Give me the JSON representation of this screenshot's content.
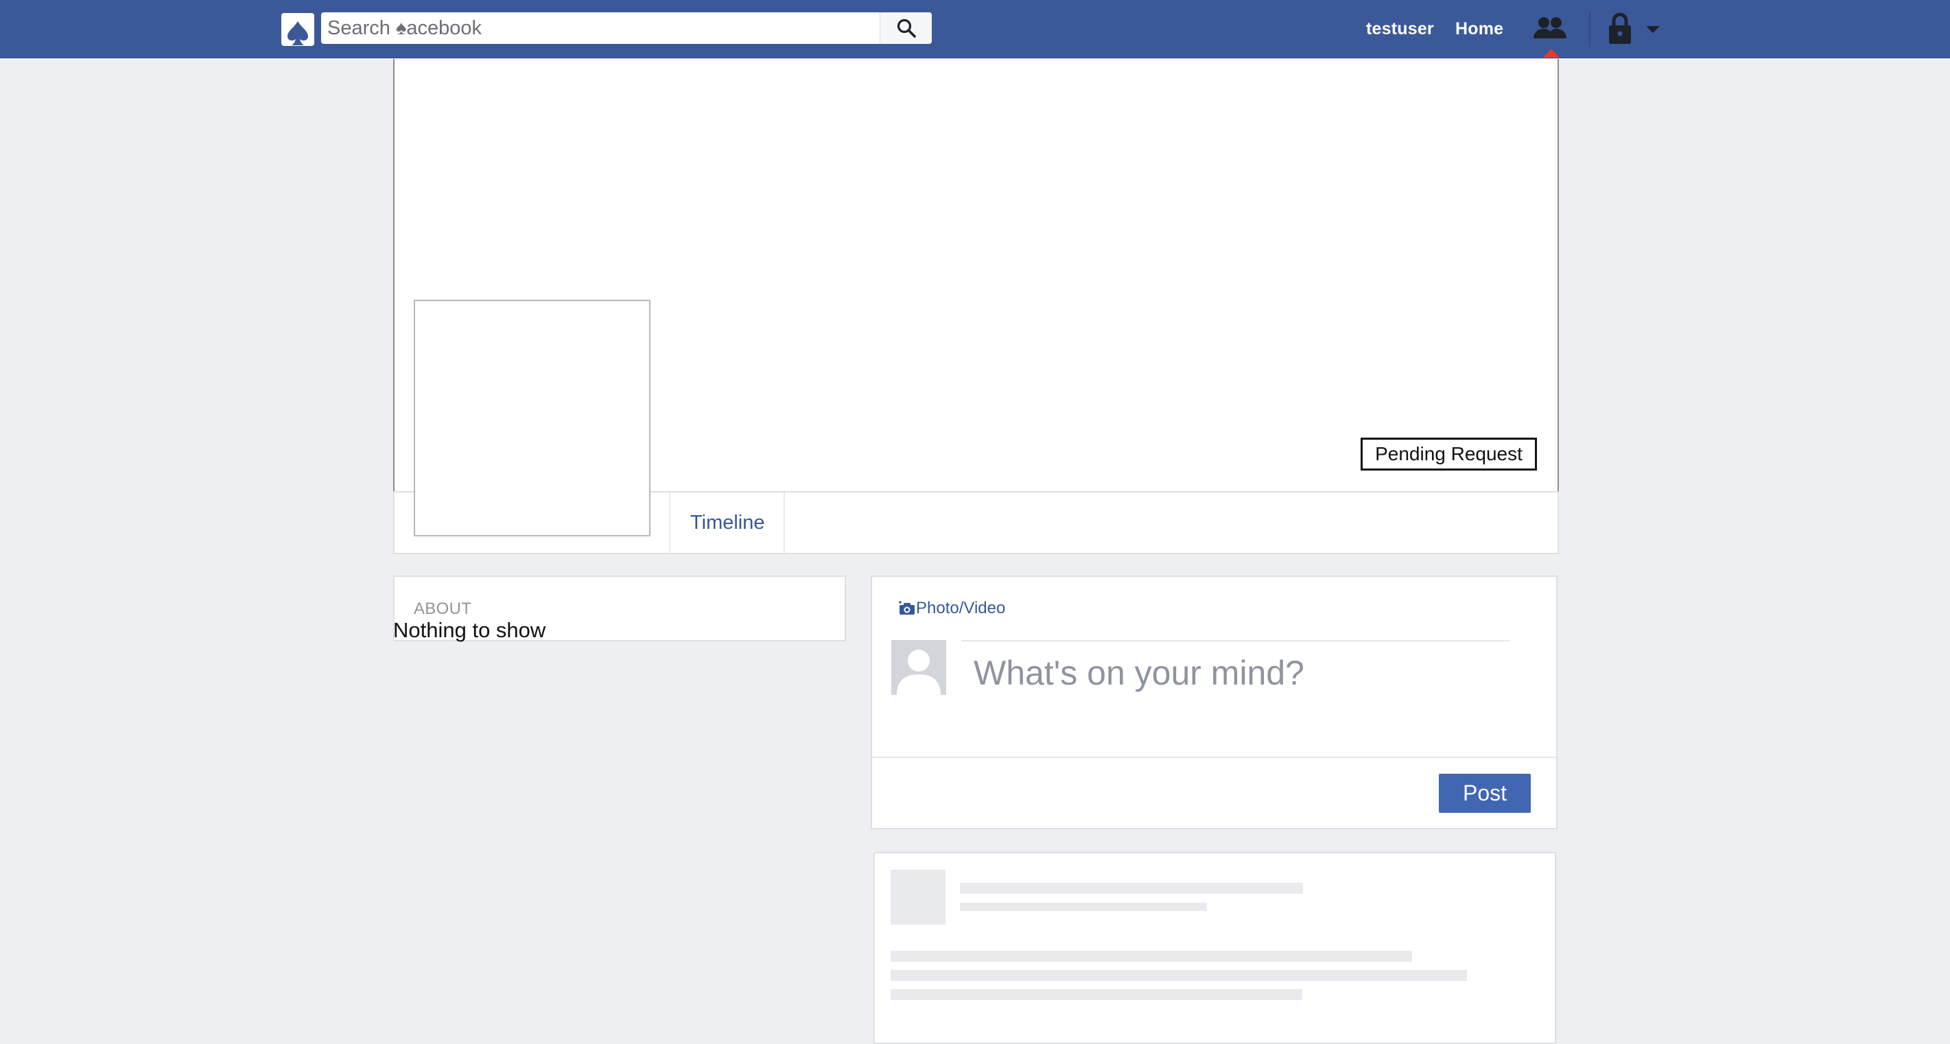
{
  "topbar": {
    "search_placeholder": "Search ♠acebook",
    "user_label": "testuser",
    "home_label": "Home",
    "icons": [
      "spade-logo-icon",
      "search-icon",
      "friends-icon",
      "lock-icon",
      "caret-down-icon"
    ],
    "colors": {
      "bar": "#3b5998",
      "notification": "#e33b2f"
    }
  },
  "profile": {
    "pending_request_label": "Pending Request",
    "tabs": [
      {
        "label": "Timeline"
      }
    ]
  },
  "about": {
    "title": "ABOUT",
    "body": "Nothing to show"
  },
  "composer": {
    "photo_video_label": "Photo/Video",
    "placeholder": "What's on your mind?",
    "post_label": "Post",
    "colors": {
      "post_button": "#4267b2",
      "link": "#365899"
    }
  }
}
